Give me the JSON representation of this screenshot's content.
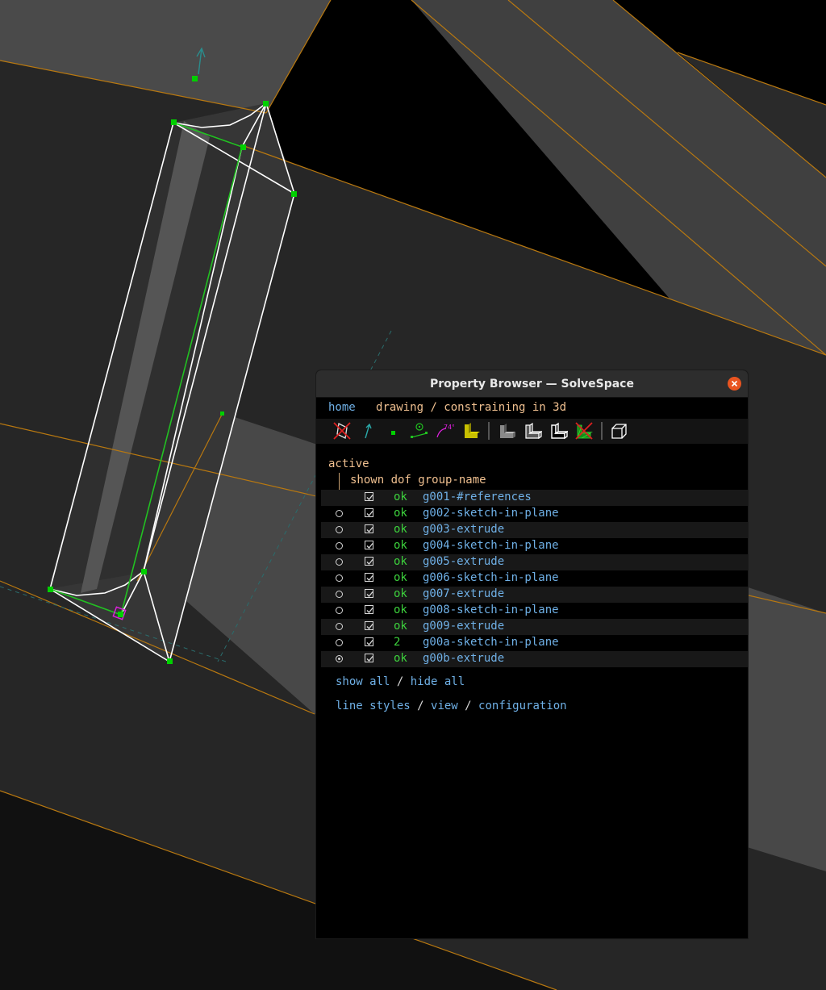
{
  "window": {
    "title": "Property Browser — SolveSpace"
  },
  "nav": {
    "home": "home",
    "mode": "drawing / constraining in 3d"
  },
  "toolbar": {
    "icons": [
      "hide-construction-icon",
      "show-normals-icon",
      "show-points-icon",
      "show-constraints-icon",
      "show-dimensions-icon",
      "show-faces-icon",
      "shaded-solid-icon",
      "edges-solid-icon",
      "outlines-solid-icon",
      "mesh-solid-icon",
      "perspective-view-icon"
    ]
  },
  "groups": {
    "active_header": "active",
    "columns_header": "shown dof group-name",
    "rows": [
      {
        "active": "none",
        "shown": true,
        "dof": "ok",
        "name": "g001-#references"
      },
      {
        "active": "off",
        "shown": true,
        "dof": "ok",
        "name": "g002-sketch-in-plane"
      },
      {
        "active": "off",
        "shown": true,
        "dof": "ok",
        "name": "g003-extrude"
      },
      {
        "active": "off",
        "shown": true,
        "dof": "ok",
        "name": "g004-sketch-in-plane"
      },
      {
        "active": "off",
        "shown": true,
        "dof": "ok",
        "name": "g005-extrude"
      },
      {
        "active": "off",
        "shown": true,
        "dof": "ok",
        "name": "g006-sketch-in-plane"
      },
      {
        "active": "off",
        "shown": true,
        "dof": "ok",
        "name": "g007-extrude"
      },
      {
        "active": "off",
        "shown": true,
        "dof": "ok",
        "name": "g008-sketch-in-plane"
      },
      {
        "active": "off",
        "shown": true,
        "dof": "ok",
        "name": "g009-extrude"
      },
      {
        "active": "off",
        "shown": true,
        "dof": "2",
        "name": "g00a-sketch-in-plane"
      },
      {
        "active": "on",
        "shown": true,
        "dof": "ok",
        "name": "g00b-extrude"
      }
    ]
  },
  "links": {
    "show_all": "show all",
    "hide_all": "hide all",
    "line_styles": "line styles",
    "view": "view",
    "configuration": "configuration",
    "separator": " / "
  },
  "colors": {
    "link": "#6fb0e6",
    "header": "#f0c090",
    "dof_ok": "#3dd23d",
    "point": "#00d000",
    "edge": "#b87810",
    "close": "#e95420"
  }
}
